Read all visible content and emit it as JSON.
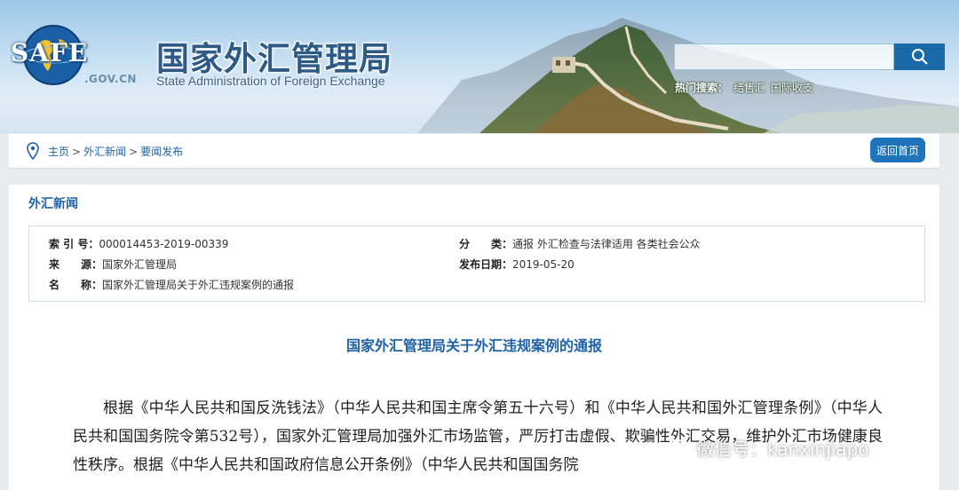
{
  "header": {
    "logo_text": "SAFE",
    "domain_suffix": ".GOV.CN",
    "title_cn": "国家外汇管理局",
    "title_en": "State Administration of Foreign Exchange",
    "hot_label": "热门搜索：",
    "hot_items": [
      "结售汇",
      "国际收支"
    ]
  },
  "search": {
    "placeholder": ""
  },
  "breadcrumb": {
    "items": [
      "主页",
      "外汇新闻",
      "要闻发布"
    ],
    "separator": ">",
    "home_button": "返回首页"
  },
  "section": {
    "title": "外汇新闻"
  },
  "meta": {
    "index_label": "索 引 号：",
    "index_value": "000014453-2019-00339",
    "category_label": "分　　类：",
    "category_value": "通报  外汇检查与法律适用  各类社会公众",
    "source_label": "来　　源：",
    "source_value": "国家外汇管理局",
    "date_label": "发布日期：",
    "date_value": "2019-05-20",
    "name_label": "名　　称：",
    "name_value": "国家外汇管理局关于外汇违规案例的通报"
  },
  "article": {
    "title": "国家外汇管理局关于外汇违规案例的通报",
    "paragraph": "根据《中华人民共和国反洗钱法》（中华人民共和国主席令第五十六号）和《中华人民共和国外汇管理条例》（中华人民共和国国务院令第532号），国家外汇管理局加强外汇市场监管，严厉打击虚假、欺骗性外汇交易，维护外汇市场健康良性秩序。根据《中华人民共和国政府信息公开条例》（中华人民共和国国务院"
  },
  "watermark": {
    "text": "微信号：kanxinjiapo"
  },
  "colors": {
    "accent": "#1f62a6",
    "button": "#1e73bb",
    "title": "#2e5a86"
  }
}
